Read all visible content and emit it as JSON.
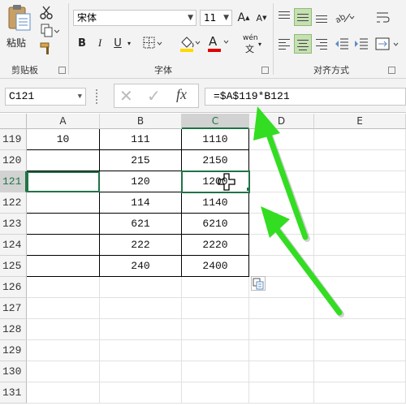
{
  "ribbon": {
    "clipboard": {
      "paste_label": "粘贴",
      "group_label": "剪贴板"
    },
    "font": {
      "font_name": "宋体",
      "font_size": "11",
      "bold": "B",
      "italic": "I",
      "underline": "U",
      "grow": "A",
      "shrink": "A",
      "font_color_letter": "A",
      "fill_color_hex": "#ffd800",
      "font_color_hex": "#e00000",
      "phonetic": "wén",
      "group_label": "字体"
    },
    "alignment": {
      "group_label": "对齐方式"
    }
  },
  "formula_bar": {
    "name_box": "C121",
    "cancel_icon": "✕",
    "enter_icon": "✓",
    "fx_label": "fx",
    "formula": "=$A$119*B121"
  },
  "sheet": {
    "columns": [
      "A",
      "B",
      "C",
      "D",
      "E"
    ],
    "rows": [
      {
        "num": "119",
        "a": "10",
        "b": "111",
        "c": "1110"
      },
      {
        "num": "120",
        "a": "",
        "b": "215",
        "c": "2150"
      },
      {
        "num": "121",
        "a": "",
        "b": "120",
        "c": "1200"
      },
      {
        "num": "122",
        "a": "",
        "b": "114",
        "c": "1140"
      },
      {
        "num": "123",
        "a": "",
        "b": "621",
        "c": "6210"
      },
      {
        "num": "124",
        "a": "",
        "b": "222",
        "c": "2220"
      },
      {
        "num": "125",
        "a": "",
        "b": "240",
        "c": "2400"
      },
      {
        "num": "126",
        "a": "",
        "b": "",
        "c": ""
      },
      {
        "num": "127",
        "a": "",
        "b": "",
        "c": ""
      },
      {
        "num": "128",
        "a": "",
        "b": "",
        "c": ""
      },
      {
        "num": "129",
        "a": "",
        "b": "",
        "c": ""
      },
      {
        "num": "130",
        "a": "",
        "b": "",
        "c": ""
      },
      {
        "num": "131",
        "a": "",
        "b": "",
        "c": ""
      }
    ]
  },
  "annotations": {
    "arrow_color": "#33dd22"
  }
}
